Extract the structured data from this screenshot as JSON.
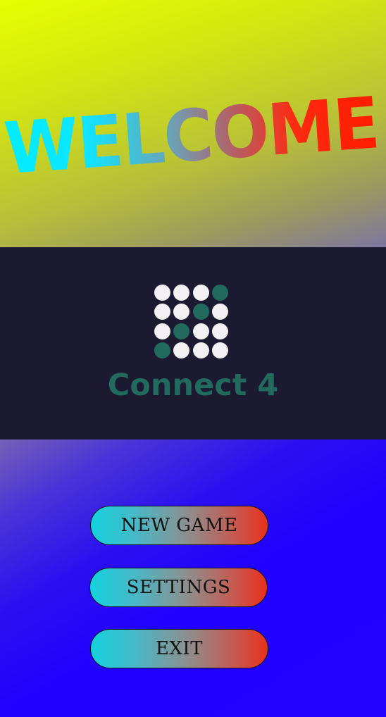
{
  "welcome": {
    "text": "WELCOME"
  },
  "logo": {
    "rows": [
      [
        "light",
        "light",
        "light",
        "dark"
      ],
      [
        "light",
        "light",
        "dark",
        "light"
      ],
      [
        "light",
        "dark",
        "light",
        "light"
      ],
      [
        "dark",
        "light",
        "light",
        "light"
      ]
    ],
    "light_color": "#f2f0f2",
    "dark_color": "#22695e"
  },
  "app": {
    "name": "Connect 4"
  },
  "menu": {
    "new_game_label": "NEW GAME",
    "settings_label": "SETTINGS",
    "exit_label": "EXIT"
  },
  "colors": {
    "top_gradient_start": "#e6ff00",
    "middle_bg": "#1c1a30",
    "bottom_bg": "#2200ff",
    "button_gradient_start": "#14d2de",
    "button_gradient_end": "#e8301c",
    "welcome_gradient_start": "#00ecff",
    "welcome_gradient_end": "#ff1c00"
  }
}
